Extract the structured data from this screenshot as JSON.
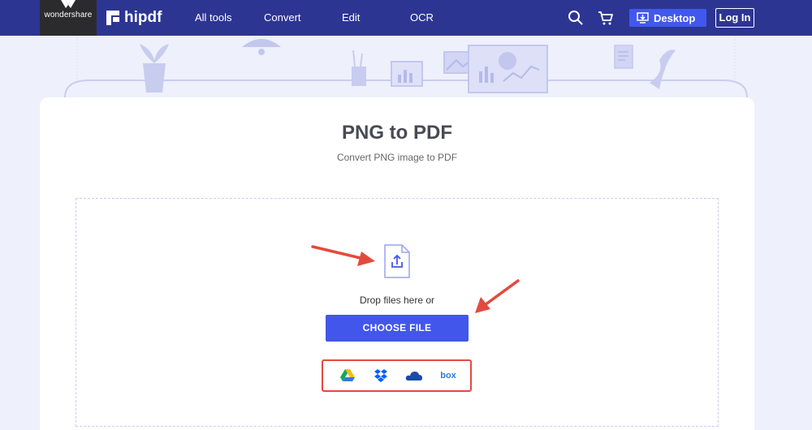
{
  "brand": {
    "wondershare": "wondershare",
    "hipdf": "hipdf"
  },
  "nav": {
    "items": [
      "All tools",
      "Convert",
      "Edit",
      "OCR"
    ],
    "desktop_label": "Desktop",
    "login_label": "Log In"
  },
  "page": {
    "title": "PNG to PDF",
    "subtitle": "Convert PNG image to PDF"
  },
  "upload": {
    "drop_text": "Drop files here or",
    "choose_label": "CHOOSE FILE",
    "cloud_sources": [
      "google-drive",
      "dropbox",
      "onedrive",
      "box"
    ],
    "box_label": "box"
  },
  "colors": {
    "nav_bg": "#2d3592",
    "accent": "#4256ec",
    "annotation": "#e34a3f"
  }
}
